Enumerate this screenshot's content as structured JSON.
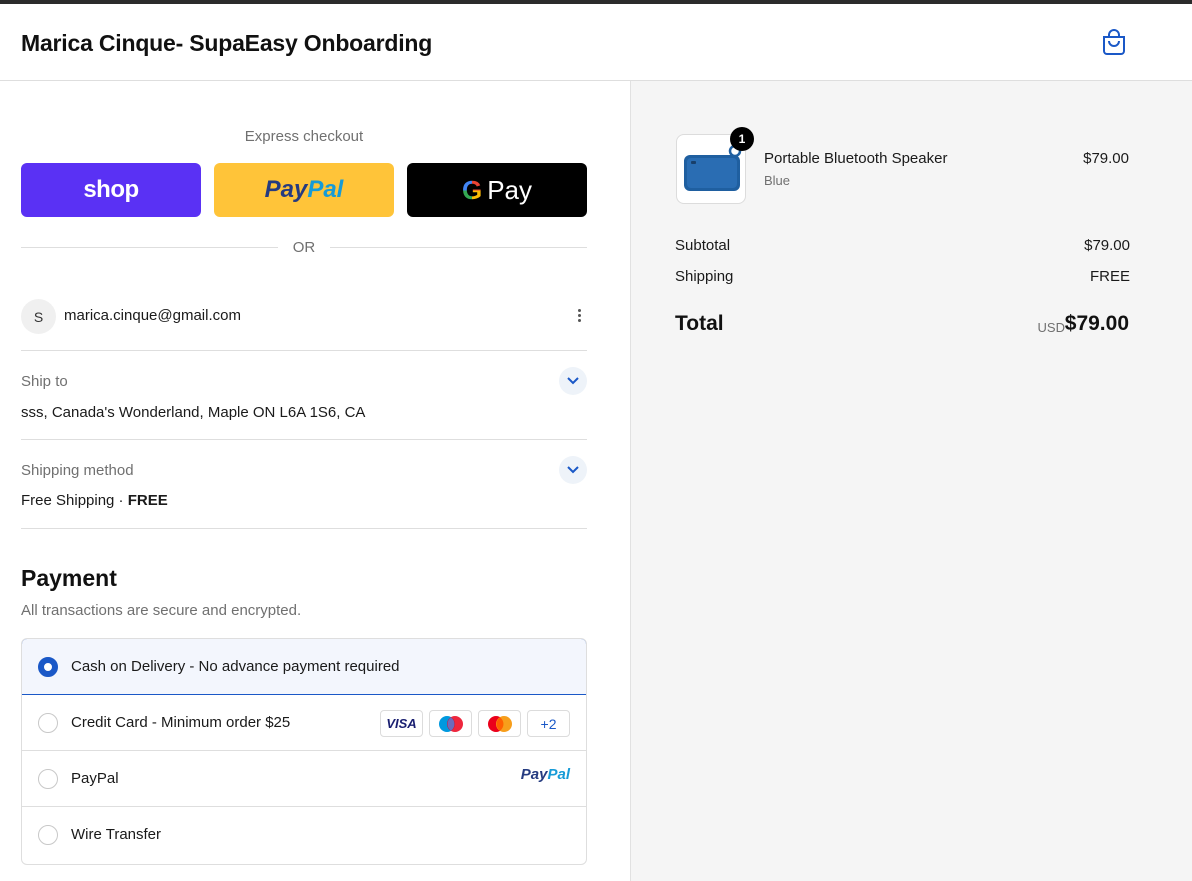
{
  "header": {
    "store_title": "Marica Cinque- SupaEasy Onboarding",
    "cart_icon": "shopping-bag-icon"
  },
  "express": {
    "label": "Express checkout",
    "shop_label": "shop",
    "paypal_part1": "Pay",
    "paypal_part2": "Pal",
    "gpay_g": "G",
    "gpay_label": "Pay",
    "or_label": "OR"
  },
  "account": {
    "avatar_letter": "S",
    "email": "marica.cinque@gmail.com"
  },
  "ship_to": {
    "label": "Ship to",
    "value": "sss, Canada's Wonderland, Maple ON L6A 1S6, CA"
  },
  "shipping_method": {
    "label": "Shipping method",
    "value": "Free Shipping · ",
    "value_strong": "FREE"
  },
  "payment": {
    "title": "Payment",
    "subtitle": "All transactions are secure and encrypted.",
    "options": [
      {
        "label": "Cash on Delivery - No advance payment required",
        "selected": true
      },
      {
        "label": "Credit Card - Minimum order $25",
        "selected": false
      },
      {
        "label": "PayPal",
        "selected": false
      },
      {
        "label": "Wire Transfer",
        "selected": false
      }
    ],
    "card_brands": {
      "visa": "VISA",
      "more": "+2"
    },
    "paypal_logo_1": "Pay",
    "paypal_logo_2": "Pal"
  },
  "summary": {
    "product": {
      "name": "Portable Bluetooth Speaker",
      "variant": "Blue",
      "price": "$79.00",
      "quantity": "1"
    },
    "subtotal_label": "Subtotal",
    "subtotal_value": "$79.00",
    "shipping_label": "Shipping",
    "shipping_value": "FREE",
    "total_label": "Total",
    "currency": "USD",
    "total_value": "$79.00"
  },
  "colors": {
    "accent": "#1a58c7",
    "shop_pay": "#5a31f4",
    "paypal_yellow": "#ffc439",
    "summary_bg": "#f5f5f5"
  }
}
